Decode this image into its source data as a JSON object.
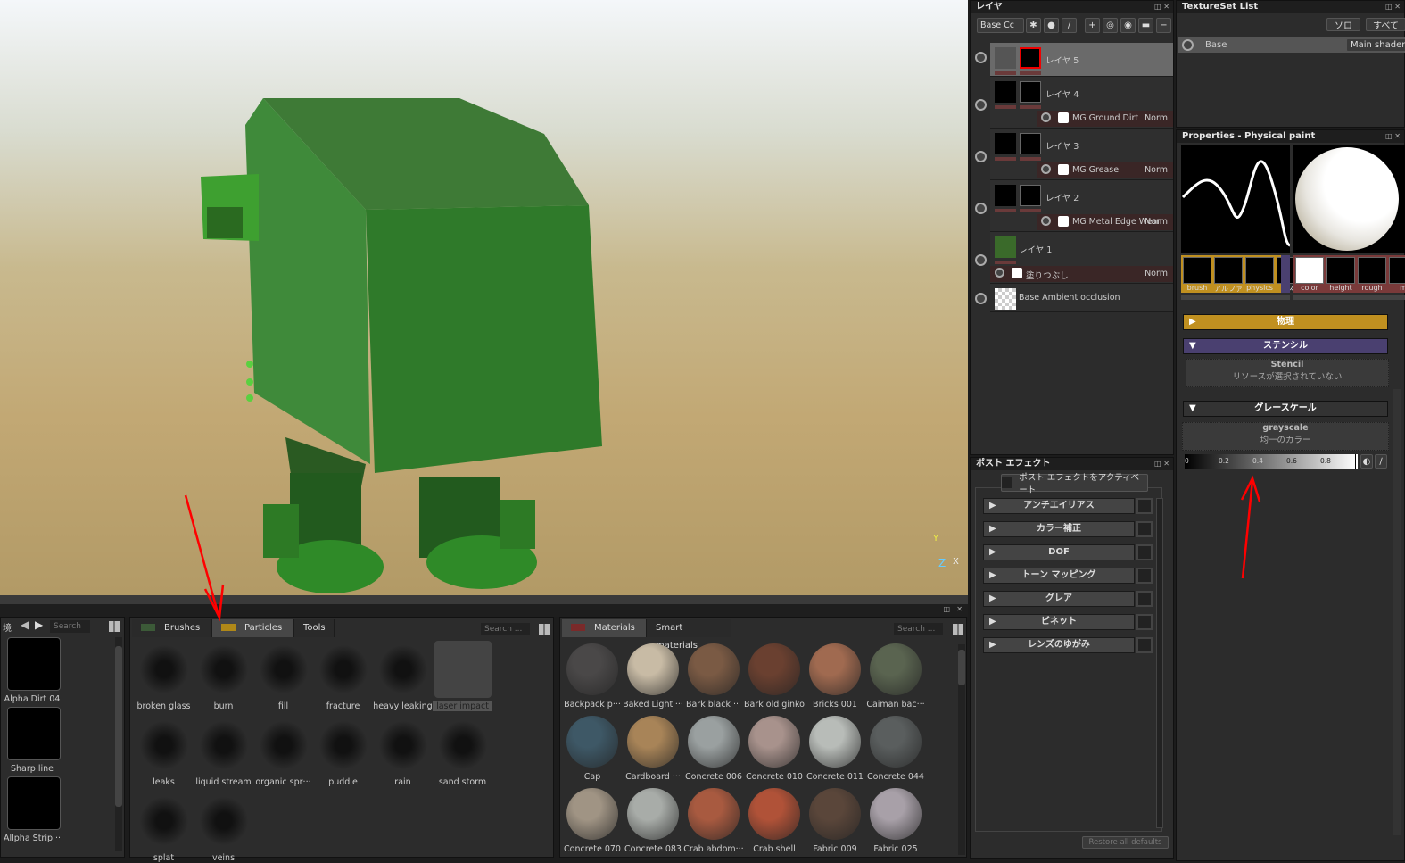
{
  "viewport": {
    "axis_y": "Y",
    "axis_z": "Z",
    "axis_x": "X"
  },
  "layers": {
    "title": "レイヤ",
    "channel_select": "Base Cc",
    "items": [
      {
        "name": "レイヤ 5",
        "selected": true
      },
      {
        "name": "レイヤ 4",
        "effect": "MG Ground Dirt",
        "blend": "Norm"
      },
      {
        "name": "レイヤ 3",
        "effect": "MG Grease",
        "blend": "Norm"
      },
      {
        "name": "レイヤ 2",
        "effect": "MG Metal Edge Wear",
        "blend": "Norm"
      },
      {
        "name": "レイヤ 1",
        "effect": "塗りつぶし",
        "blend": "Norm"
      },
      {
        "name": "Base Ambient occlusion"
      }
    ]
  },
  "texture_set": {
    "title": "TextureSet List",
    "solo": "ソロ",
    "all": "すべて",
    "item": "Base",
    "shader": "Main shader"
  },
  "properties": {
    "title": "Properties - Physical paint",
    "slots_left": [
      "brush",
      "アルファ",
      "physics",
      "ス"
    ],
    "slots_right": [
      "color",
      "height",
      "rough",
      "m"
    ],
    "physics": "物理",
    "stencil_header": "ステンシル",
    "stencil_title": "Stencil",
    "stencil_empty": "リソースが選択されていない",
    "gray_header": "グレースケール",
    "gray_title": "grayscale",
    "gray_value": "均一のカラー",
    "ticks": [
      "0",
      "0.2",
      "0.4",
      "0.6",
      "0.8"
    ]
  },
  "post": {
    "title": "ポスト エフェクト",
    "activate": "ポスト エフェクトをアクティベート",
    "items": [
      "アンチエイリアス",
      "カラー補正",
      "DOF",
      "トーン マッピング",
      "グレア",
      "ビネット",
      "レンズのゆがみ"
    ],
    "restore": "Restore all defaults"
  },
  "shelf_left": {
    "tab": "境",
    "search": "Search ...",
    "items": [
      "Alpha Dirt 04",
      "Sharp line",
      "Allpha Strip···"
    ]
  },
  "shelf_mid": {
    "tabs": [
      "Brushes",
      "Particles",
      "Tools"
    ],
    "search": "Search ...",
    "items": [
      "broken glass",
      "burn",
      "fill",
      "fracture",
      "heavy leaking",
      "laser impact",
      "leaks",
      "liquid stream",
      "organic spr···",
      "puddle",
      "rain",
      "sand storm",
      "splat",
      "veins"
    ]
  },
  "shelf_right": {
    "tabs": [
      "Materials",
      "Smart materials"
    ],
    "search": "Search ...",
    "items": [
      {
        "n": "Backpack p···",
        "c": "#4a4848"
      },
      {
        "n": "Baked Lighti···",
        "c": "#c8bba5"
      },
      {
        "n": "Bark black ···",
        "c": "#7a5a44"
      },
      {
        "n": "Bark old ginko",
        "c": "#6a4030"
      },
      {
        "n": "Bricks 001",
        "c": "#a06a50"
      },
      {
        "n": "Caiman bac···",
        "c": "#5a6450"
      },
      {
        "n": "Cap",
        "c": "#3e5866"
      },
      {
        "n": "Cardboard ···",
        "c": "#a88458"
      },
      {
        "n": "Concrete 006",
        "c": "#9aa0a0"
      },
      {
        "n": "Concrete 010",
        "c": "#a8928c"
      },
      {
        "n": "Concrete 011",
        "c": "#b8bcb8"
      },
      {
        "n": "Concrete 044",
        "c": "#5a5e5e"
      },
      {
        "n": "Concrete 070",
        "c": "#a09484"
      },
      {
        "n": "Concrete 083",
        "c": "#a8aca8"
      },
      {
        "n": "Crab abdom···",
        "c": "#a85a40"
      },
      {
        "n": "Crab shell",
        "c": "#b05238"
      },
      {
        "n": "Fabric 009",
        "c": "#5a463a"
      },
      {
        "n": "Fabric 025",
        "c": "#a8a0a8"
      }
    ]
  }
}
